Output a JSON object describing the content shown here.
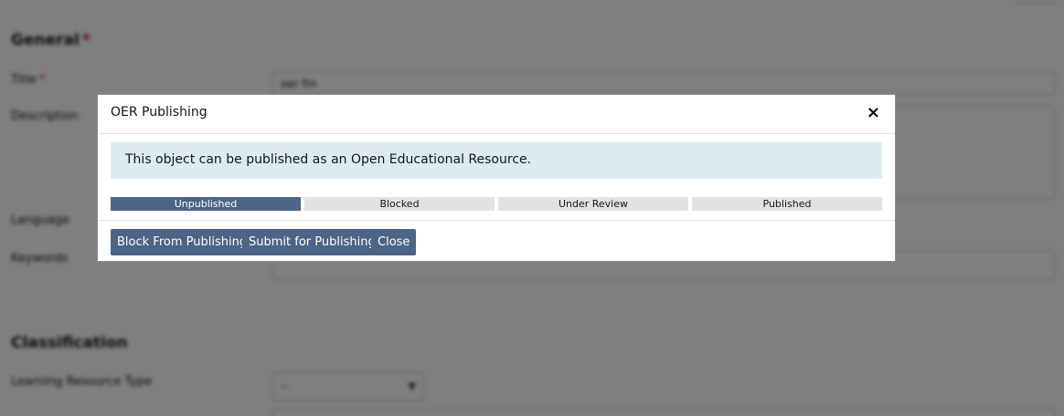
{
  "background": {
    "general_heading": "General",
    "required_mark": "*",
    "title_label": "Title",
    "title_value": "oer fm",
    "description_label": "Description",
    "language_label": "Language",
    "keywords_label": "Keywords",
    "classification_heading": "Classification",
    "learning_resource_type_label": "Learning Resource Type",
    "learning_resource_type_value": "--"
  },
  "modal": {
    "title": "OER Publishing",
    "close_symbol": "×",
    "info_message": "This object can be published as an Open Educational Resource.",
    "status_steps": [
      {
        "label": "Unpublished",
        "active": true
      },
      {
        "label": "Blocked",
        "active": false
      },
      {
        "label": "Under Review",
        "active": false
      },
      {
        "label": "Published",
        "active": false
      }
    ],
    "buttons": {
      "block": "Block From Publishing",
      "submit": "Submit for Publishing",
      "close": "Close"
    }
  },
  "colors": {
    "primary_button": "#4c6586",
    "info_background": "#dcebf2",
    "inactive_step": "#e2e2e2"
  }
}
